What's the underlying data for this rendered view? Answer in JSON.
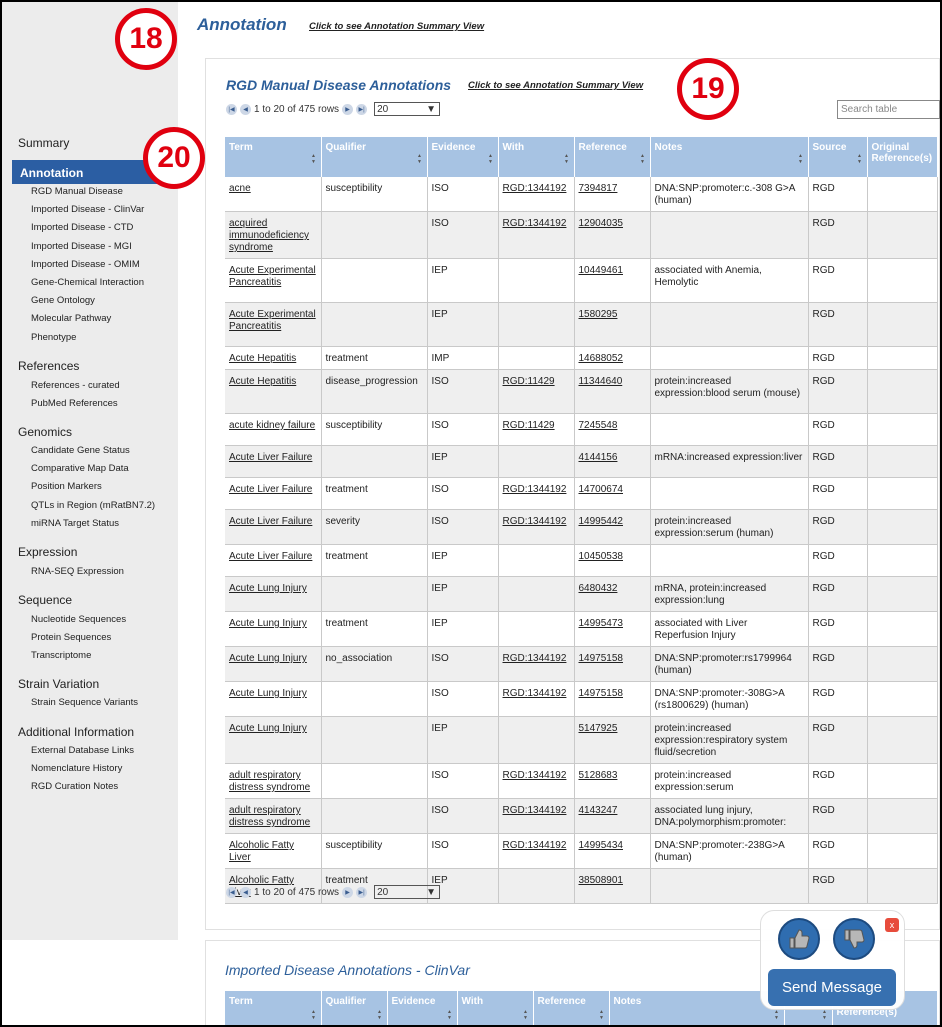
{
  "header": {
    "title": "Annotation",
    "summary_link": "Click to see Annotation Summary View"
  },
  "sidebar": {
    "summary": "Summary",
    "annotation": "Annotation",
    "annotation_items": [
      "RGD Manual Disease",
      "Imported Disease - ClinVar",
      "Imported Disease - CTD",
      "Imported Disease - MGI",
      "Imported Disease - OMIM",
      "Gene-Chemical Interaction",
      "Gene Ontology",
      "Molecular Pathway",
      "Phenotype"
    ],
    "references": "References",
    "references_items": [
      "References - curated",
      "PubMed References"
    ],
    "genomics": "Genomics",
    "genomics_items": [
      "Candidate Gene Status",
      "Comparative Map Data",
      "Position Markers",
      "QTLs in Region (mRatBN7.2)",
      "miRNA Target Status"
    ],
    "expression": "Expression",
    "expression_items": [
      "RNA-SEQ Expression"
    ],
    "sequence": "Sequence",
    "sequence_items": [
      "Nucleotide Sequences",
      "Protein Sequences",
      "Transcriptome"
    ],
    "strain": "Strain Variation",
    "strain_items": [
      "Strain Sequence Variants"
    ],
    "additional": "Additional Information",
    "additional_items": [
      "External Database Links",
      "Nomenclature History",
      "RGD Curation Notes"
    ]
  },
  "manual": {
    "title": "RGD Manual Disease Annotations",
    "summary_link": "Click to see Annotation Summary View",
    "pager_text": "1 to 20 of 475 rows",
    "page_size": "20",
    "search_placeholder": "Search table",
    "columns": [
      "Term",
      "Qualifier",
      "Evidence",
      "With",
      "Reference",
      "Notes",
      "Source",
      "Original Reference(s)"
    ],
    "rows": [
      {
        "term": "acne",
        "qualifier": "susceptibility",
        "evidence": "ISO",
        "with": "RGD:1344192",
        "reference": "7394817",
        "notes": "DNA:SNP:promoter:c.-308 G>A (human)",
        "source": "RGD"
      },
      {
        "term": "acquired immunodeficiency syndrome",
        "qualifier": "",
        "evidence": "ISO",
        "with": "RGD:1344192",
        "reference": "12904035",
        "notes": "",
        "source": "RGD"
      },
      {
        "term": "Acute Experimental Pancreatitis",
        "qualifier": "",
        "evidence": "IEP",
        "with": "",
        "reference": "10449461",
        "notes": "associated with Anemia, Hemolytic",
        "source": "RGD"
      },
      {
        "term": "Acute Experimental Pancreatitis",
        "qualifier": "",
        "evidence": "IEP",
        "with": "",
        "reference": "1580295",
        "notes": "",
        "source": "RGD"
      },
      {
        "term": "Acute Hepatitis",
        "qualifier": "treatment",
        "evidence": "IMP",
        "with": "",
        "reference": "14688052",
        "notes": "",
        "source": "RGD"
      },
      {
        "term": "Acute Hepatitis",
        "qualifier": "disease_progression",
        "evidence": "ISO",
        "with": "RGD:11429",
        "reference": "11344640",
        "notes": "protein:increased expression:blood serum (mouse)",
        "source": "RGD"
      },
      {
        "term": "acute kidney failure",
        "qualifier": "susceptibility",
        "evidence": "ISO",
        "with": "RGD:11429",
        "reference": "7245548",
        "notes": "",
        "source": "RGD"
      },
      {
        "term": "Acute Liver Failure",
        "qualifier": "",
        "evidence": "IEP",
        "with": "",
        "reference": "4144156",
        "notes": "mRNA:increased expression:liver",
        "source": "RGD"
      },
      {
        "term": "Acute Liver Failure",
        "qualifier": "treatment",
        "evidence": "ISO",
        "with": "RGD:1344192",
        "reference": "14700674",
        "notes": "",
        "source": "RGD"
      },
      {
        "term": "Acute Liver Failure",
        "qualifier": "severity",
        "evidence": "ISO",
        "with": "RGD:1344192",
        "reference": "14995442",
        "notes": "protein:increased expression:serum (human)",
        "source": "RGD"
      },
      {
        "term": "Acute Liver Failure",
        "qualifier": "treatment",
        "evidence": "IEP",
        "with": "",
        "reference": "10450538",
        "notes": "",
        "source": "RGD"
      },
      {
        "term": "Acute Lung Injury",
        "qualifier": "",
        "evidence": "IEP",
        "with": "",
        "reference": "6480432",
        "notes": "mRNA, protein:increased expression:lung",
        "source": "RGD"
      },
      {
        "term": "Acute Lung Injury",
        "qualifier": "treatment",
        "evidence": "IEP",
        "with": "",
        "reference": "14995473",
        "notes": "associated with Liver Reperfusion Injury",
        "source": "RGD"
      },
      {
        "term": "Acute Lung Injury",
        "qualifier": "no_association",
        "evidence": "ISO",
        "with": "RGD:1344192",
        "reference": "14975158",
        "notes": "DNA:SNP:promoter:rs1799964 (human)",
        "source": "RGD"
      },
      {
        "term": "Acute Lung Injury",
        "qualifier": "",
        "evidence": "ISO",
        "with": "RGD:1344192",
        "reference": "14975158",
        "notes": "DNA:SNP:promoter:-308G>A (rs1800629) (human)",
        "source": "RGD"
      },
      {
        "term": "Acute Lung Injury",
        "qualifier": "",
        "evidence": "IEP",
        "with": "",
        "reference": "5147925",
        "notes": "protein:increased expression:respiratory system fluid/secretion",
        "source": "RGD"
      },
      {
        "term": "adult respiratory distress syndrome",
        "qualifier": "",
        "evidence": "ISO",
        "with": "RGD:1344192",
        "reference": "5128683",
        "notes": "protein:increased expression:serum",
        "source": "RGD"
      },
      {
        "term": "adult respiratory distress syndrome",
        "qualifier": "",
        "evidence": "ISO",
        "with": "RGD:1344192",
        "reference": "4143247",
        "notes": "associated lung injury, DNA:polymorphism:promoter:",
        "source": "RGD"
      },
      {
        "term": "Alcoholic Fatty Liver",
        "qualifier": "susceptibility",
        "evidence": "ISO",
        "with": "RGD:1344192",
        "reference": "14995434",
        "notes": "DNA:SNP:promoter:-238G>A (human)",
        "source": "RGD"
      },
      {
        "term": "Alcoholic Fatty Liver",
        "qualifier": "treatment",
        "evidence": "IEP",
        "with": "",
        "reference": "38508901",
        "notes": "",
        "source": "RGD"
      }
    ]
  },
  "clinvar": {
    "title": "Imported Disease Annotations - ClinVar",
    "columns": [
      "Term",
      "Qualifier",
      "Evidence",
      "With",
      "Reference",
      "Notes",
      "Source",
      "Original Reference(s)"
    ]
  },
  "badges": {
    "b18": "18",
    "b19": "19",
    "b20": "20"
  },
  "feedback": {
    "send_label": "Send Message",
    "close_label": "x"
  }
}
